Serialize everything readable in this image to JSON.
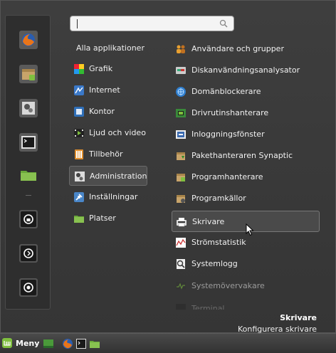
{
  "search": {
    "value": "",
    "placeholder": ""
  },
  "categories_header": "Alla applikationer",
  "categories": [
    {
      "label": "Grafik",
      "icon": "graphics-icon"
    },
    {
      "label": "Internet",
      "icon": "internet-icon"
    },
    {
      "label": "Kontor",
      "icon": "office-icon"
    },
    {
      "label": "Ljud och video",
      "icon": "multimedia-icon"
    },
    {
      "label": "Tillbehör",
      "icon": "accessories-icon"
    },
    {
      "label": "Administration",
      "icon": "administration-icon",
      "selected": true
    },
    {
      "label": "Inställningar",
      "icon": "settings-icon"
    },
    {
      "label": "Platser",
      "icon": "places-folder-icon"
    }
  ],
  "applications": [
    {
      "label": "Användare och grupper",
      "icon": "users-groups-icon"
    },
    {
      "label": "Diskanvändningsanalysator",
      "icon": "disk-usage-icon"
    },
    {
      "label": "Domänblockerare",
      "icon": "domain-blocker-icon"
    },
    {
      "label": "Drivrutinshanterare",
      "icon": "driver-manager-icon"
    },
    {
      "label": "Inloggningsfönster",
      "icon": "login-window-icon"
    },
    {
      "label": "Pakethanteraren Synaptic",
      "icon": "synaptic-icon"
    },
    {
      "label": "Programhanterare",
      "icon": "software-manager-icon"
    },
    {
      "label": "Programkällor",
      "icon": "software-sources-icon"
    },
    {
      "label": "Skrivare",
      "icon": "printer-icon",
      "selected": true
    },
    {
      "label": "Strömstatistik",
      "icon": "power-statistics-icon"
    },
    {
      "label": "Systemlogg",
      "icon": "system-log-icon"
    },
    {
      "label": "Systemövervakare",
      "icon": "system-monitor-icon"
    },
    {
      "label": "Terminal",
      "icon": "terminal-icon"
    }
  ],
  "favorites": [
    "firefox-icon",
    "software-manager-icon",
    "system-settings-icon",
    "terminal-icon",
    "home-folder-icon",
    "lock-screen-icon",
    "logout-icon",
    "shutdown-icon"
  ],
  "description": {
    "title": "Skrivare",
    "text": "Konfigurera skrivare"
  },
  "taskbar": {
    "menu_label": "Meny",
    "launchers": [
      "show-desktop-icon",
      "firefox-icon",
      "terminal-icon",
      "files-icon"
    ]
  },
  "colors": {
    "background": "#3a3a3a",
    "selection": "#4a4a4a",
    "mint_green": "#7fbf3f"
  }
}
